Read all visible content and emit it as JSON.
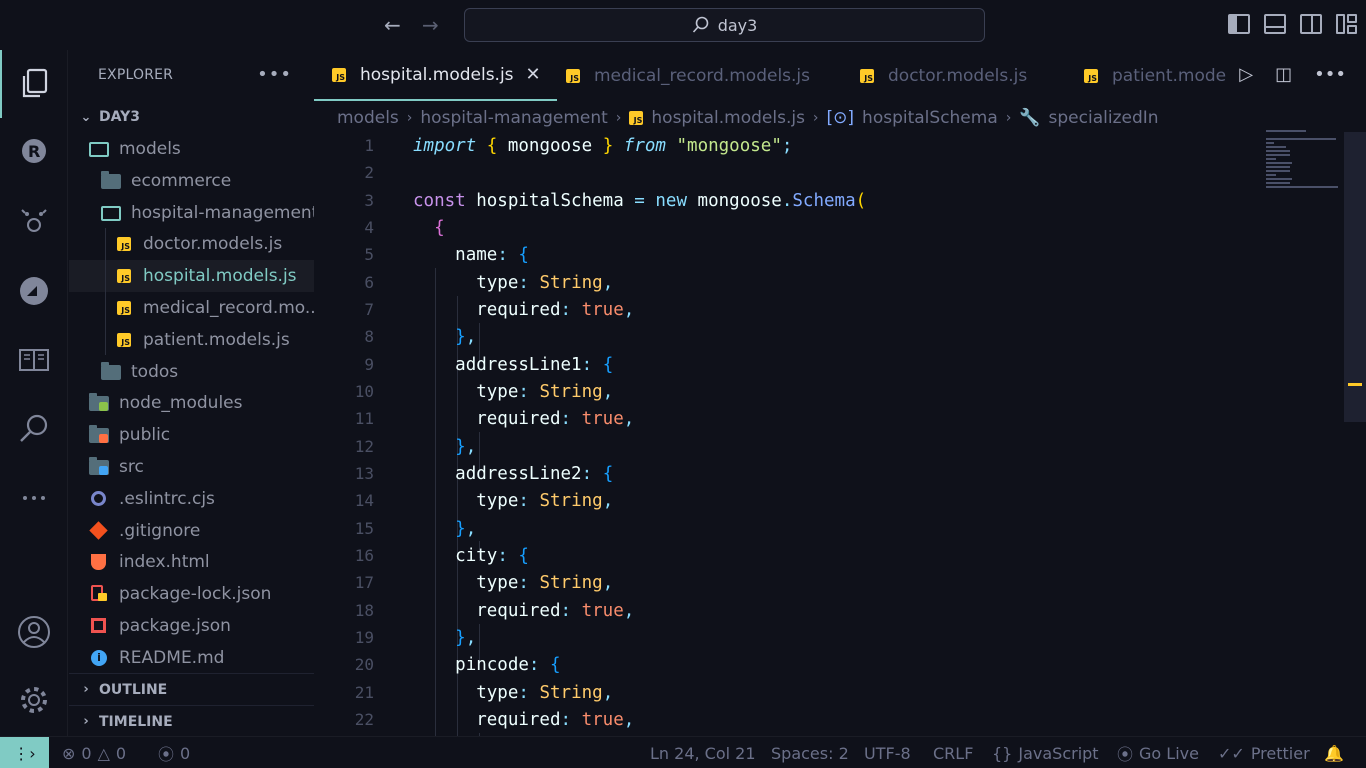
{
  "title_bar": {
    "search_text": "day3",
    "back_icon": "arrow-left-icon",
    "forward_icon": "arrow-right-icon"
  },
  "sidebar": {
    "header": "EXPLORER",
    "root_folder": "DAY3",
    "tree": [
      {
        "label": "models",
        "type": "folder-open",
        "level": 1
      },
      {
        "label": "ecommerce",
        "type": "folder",
        "level": 2
      },
      {
        "label": "hospital-management",
        "type": "folder-open",
        "level": 2
      },
      {
        "label": "doctor.models.js",
        "type": "js",
        "level": 3
      },
      {
        "label": "hospital.models.js",
        "type": "js",
        "level": 3,
        "selected": true
      },
      {
        "label": "medical_record.mo...",
        "type": "js",
        "level": 3
      },
      {
        "label": "patient.models.js",
        "type": "js",
        "level": 3
      },
      {
        "label": "todos",
        "type": "folder",
        "level": 2
      },
      {
        "label": "node_modules",
        "type": "folder-node",
        "level": 1
      },
      {
        "label": "public",
        "type": "folder-public",
        "level": 1
      },
      {
        "label": "src",
        "type": "folder-src",
        "level": 1
      },
      {
        "label": ".eslintrc.cjs",
        "type": "eslint",
        "level": 1
      },
      {
        "label": ".gitignore",
        "type": "git",
        "level": 1
      },
      {
        "label": "index.html",
        "type": "html",
        "level": 1
      },
      {
        "label": "package-lock.json",
        "type": "lock",
        "level": 1
      },
      {
        "label": "package.json",
        "type": "npm",
        "level": 1
      },
      {
        "label": "README.md",
        "type": "info",
        "level": 1
      }
    ],
    "outline": "OUTLINE",
    "timeline": "TIMELINE"
  },
  "tabs": [
    {
      "label": "hospital.models.js",
      "active": true
    },
    {
      "label": "medical_record.models.js",
      "active": false
    },
    {
      "label": "doctor.models.js",
      "active": false
    },
    {
      "label": "patient.models.js",
      "active": false
    }
  ],
  "breadcrumb": {
    "p1": "models",
    "p2": "hospital-management",
    "p3": "hospital.models.js",
    "p4": "hospitalSchema",
    "p5": "specializedIn"
  },
  "code_lines": [
    "1",
    "2",
    "3",
    "4",
    "5",
    "6",
    "7",
    "8",
    "9",
    "10",
    "11",
    "12",
    "13",
    "14",
    "15",
    "16",
    "17",
    "18",
    "19",
    "20",
    "21",
    "22"
  ],
  "code": {
    "import_kw": "import",
    "mongoose_ident": "mongoose",
    "from_kw": "from",
    "mongoose_str": "\"mongoose\"",
    "const_kw": "const",
    "schema_name": "hospitalSchema",
    "new_kw": "new",
    "schema_cls": "Schema",
    "f_name": "name",
    "f_address1": "addressLine1",
    "f_address2": "addressLine2",
    "f_city": "city",
    "f_pincode": "pincode",
    "type_key": "type",
    "required_key": "required",
    "string_type": "String",
    "true_val": "true"
  },
  "status_bar": {
    "errors": "0",
    "warnings": "0",
    "ports": "0",
    "position": "Ln 24, Col 21",
    "spaces": "Spaces: 2",
    "encoding": "UTF-8",
    "eol": "CRLF",
    "language": "JavaScript",
    "live": "Go Live",
    "formatter": "Prettier"
  }
}
